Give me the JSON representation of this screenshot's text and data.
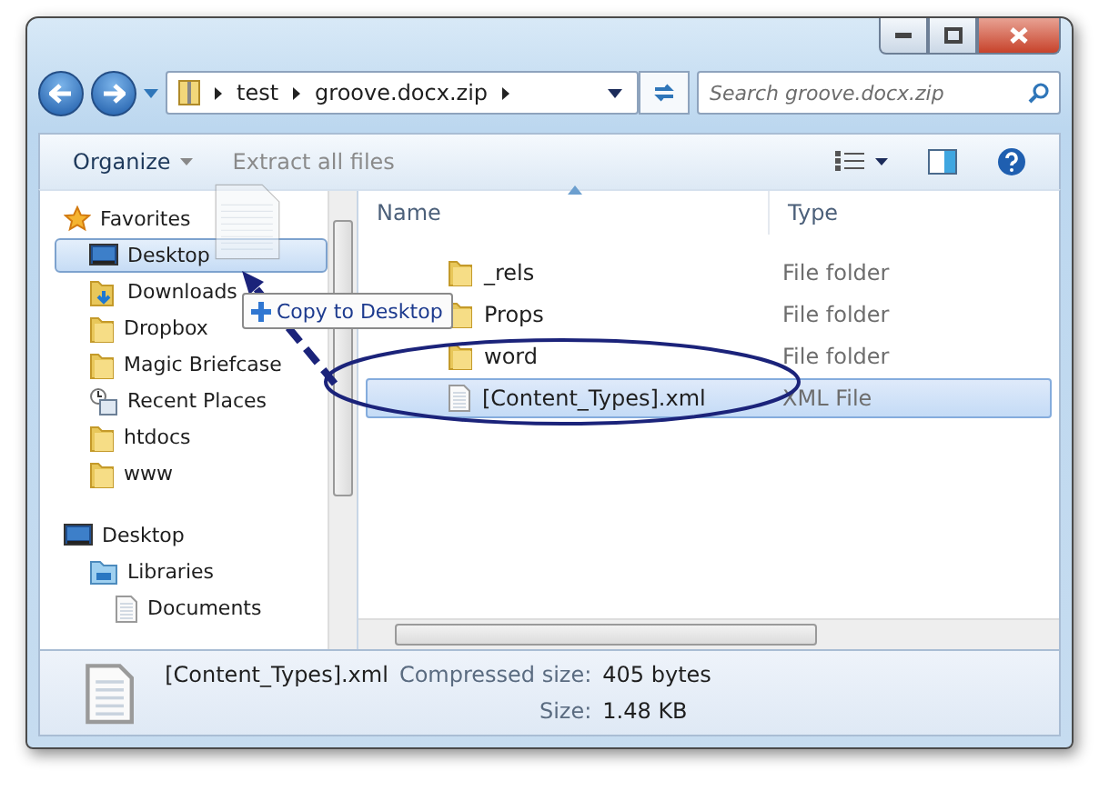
{
  "address": {
    "segments": [
      "test",
      "groove.docx.zip"
    ]
  },
  "search": {
    "placeholder": "Search groove.docx.zip"
  },
  "toolbar": {
    "organize": "Organize",
    "extract": "Extract all files"
  },
  "sidebar": {
    "groups": [
      {
        "label": "Favorites",
        "kind": "star",
        "selected": false,
        "children": [
          {
            "label": "Desktop",
            "kind": "desktop",
            "selected": true
          },
          {
            "label": "Downloads",
            "kind": "downloads",
            "selected": false
          },
          {
            "label": "Dropbox",
            "kind": "folder",
            "selected": false
          },
          {
            "label": "Magic Briefcase",
            "kind": "folder",
            "selected": false
          },
          {
            "label": "Recent Places",
            "kind": "recent",
            "selected": false
          },
          {
            "label": "htdocs",
            "kind": "folder",
            "selected": false
          },
          {
            "label": "www",
            "kind": "folder",
            "selected": false
          }
        ]
      },
      {
        "label": "Desktop",
        "kind": "desktop",
        "selected": false,
        "children": [
          {
            "label": "Libraries",
            "kind": "library",
            "selected": false,
            "children": [
              {
                "label": "Documents",
                "kind": "document",
                "selected": false
              }
            ]
          }
        ]
      }
    ]
  },
  "files": {
    "columns": [
      "Name",
      "Type"
    ],
    "rows": [
      {
        "name": "_rels",
        "type": "File folder",
        "kind": "folder",
        "selected": false
      },
      {
        "name": "Props",
        "type": "File folder",
        "kind": "folder",
        "selected": false
      },
      {
        "name": "word",
        "type": "File folder",
        "kind": "folder",
        "selected": false
      },
      {
        "name": "[Content_Types].xml",
        "type": "XML File",
        "kind": "file",
        "selected": true
      }
    ]
  },
  "details": {
    "name": "[Content_Types].xml",
    "fields": [
      {
        "label": "Compressed size:",
        "value": "405 bytes"
      },
      {
        "label": "Size:",
        "value": "1.48 KB"
      }
    ]
  },
  "drag": {
    "tooltip": "Copy to Desktop"
  }
}
